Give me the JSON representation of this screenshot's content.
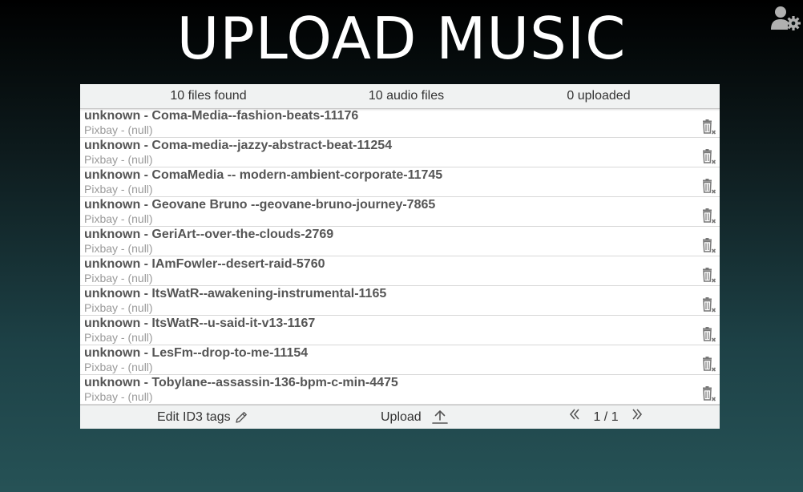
{
  "header": {
    "title": "UPLOAD MUSIC",
    "user_settings_icon": "user-gear-icon"
  },
  "stats": {
    "files_found": "10 files found",
    "audio_files": "10 audio files",
    "uploaded": "0 uploaded"
  },
  "files": [
    {
      "title": "unknown - Coma-Media--fashion-beats-11176",
      "subtitle": "Pixbay - (null)"
    },
    {
      "title": "unknown - Coma-media--jazzy-abstract-beat-11254",
      "subtitle": "Pixbay - (null)"
    },
    {
      "title": "unknown - ComaMedia -- modern-ambient-corporate-11745",
      "subtitle": "Pixbay - (null)"
    },
    {
      "title": "unknown - Geovane Bruno --geovane-bruno-journey-7865",
      "subtitle": "Pixbay - (null)"
    },
    {
      "title": "unknown - GeriArt--over-the-clouds-2769",
      "subtitle": "Pixbay - (null)"
    },
    {
      "title": "unknown - IAmFowler--desert-raid-5760",
      "subtitle": "Pixbay - (null)"
    },
    {
      "title": "unknown - ItsWatR--awakening-instrumental-1165",
      "subtitle": "Pixbay - (null)"
    },
    {
      "title": "unknown - ItsWatR--u-said-it-v13-1167",
      "subtitle": "Pixbay - (null)"
    },
    {
      "title": "unknown - LesFm--drop-to-me-11154",
      "subtitle": "Pixbay - (null)"
    },
    {
      "title": "unknown - Tobylane--assassin-136-bpm-c-min-4475",
      "subtitle": "Pixbay - (null)"
    }
  ],
  "footer": {
    "edit_label": "Edit ID3 tags",
    "upload_label": "Upload",
    "pagination": "1 / 1"
  },
  "icons": {
    "delete": "trash-delete-icon",
    "edit": "pencil-icon",
    "upload": "upload-icon",
    "prev": "double-chevron-left-icon",
    "next": "double-chevron-right-icon"
  },
  "colors": {
    "background_top": "#000000",
    "background_bottom": "#265256",
    "bar_background": "#f0f2f2",
    "title_text": "#ffffff",
    "file_title": "#555555",
    "file_subtitle": "#9a9a9a",
    "icon_gray": "#777777"
  }
}
